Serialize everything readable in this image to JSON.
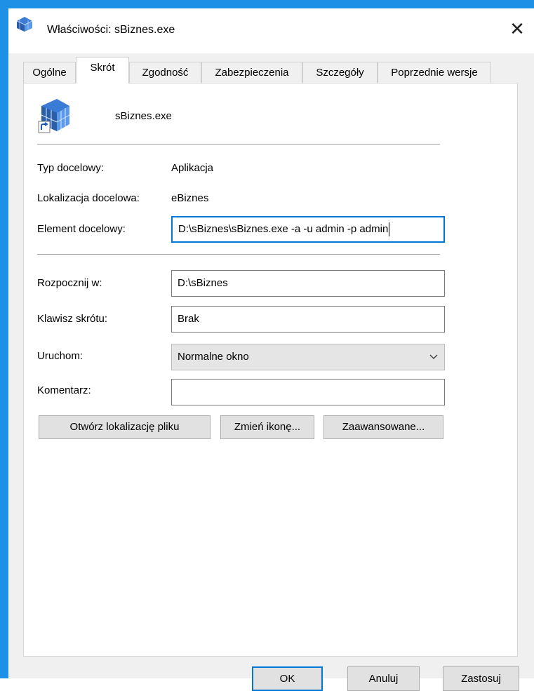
{
  "window": {
    "title": "Właściwości: sBiznes.exe",
    "close_symbol": "✕",
    "accent_color": "#1e90e6"
  },
  "tabs": [
    {
      "label": "Ogólne"
    },
    {
      "label": "Skrót",
      "active": true
    },
    {
      "label": "Zgodność"
    },
    {
      "label": "Zabezpieczenia"
    },
    {
      "label": "Szczegóły"
    },
    {
      "label": "Poprzednie wersje"
    }
  ],
  "shortcut": {
    "icon": "application-cube-icon",
    "name": "sBiznes.exe"
  },
  "fields": {
    "target_type_label": "Typ docelowy:",
    "target_type_value": "Aplikacja",
    "target_location_label": "Lokalizacja docelowa:",
    "target_location_value": "eBiznes",
    "target_label": "Element docelowy:",
    "target_value": "D:\\sBiznes\\sBiznes.exe -a -u admin -p admin",
    "start_in_label": "Rozpocznij w:",
    "start_in_value": "D:\\sBiznes",
    "hotkey_label": "Klawisz skrótu:",
    "hotkey_value": "Brak",
    "run_label": "Uruchom:",
    "run_value": "Normalne okno",
    "comment_label": "Komentarz:",
    "comment_value": ""
  },
  "actions": {
    "open_location": "Otwórz lokalizację pliku",
    "change_icon": "Zmień ikonę...",
    "advanced": "Zaawansowane..."
  },
  "footer": {
    "ok": "OK",
    "cancel": "Anuluj",
    "apply": "Zastosuj"
  }
}
